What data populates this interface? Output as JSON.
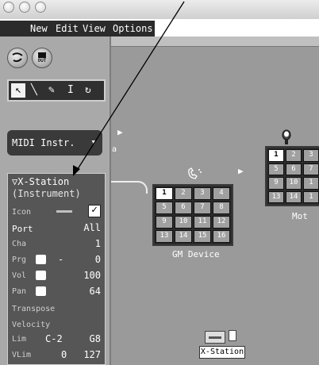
{
  "menubar": {
    "items": [
      "New",
      "Edit",
      "View",
      "Options"
    ]
  },
  "toolbar": {
    "out_label": "OUT"
  },
  "tools": [
    {
      "glyph": "↖",
      "icon": "pointer-tool-icon"
    },
    {
      "glyph": "╲",
      "icon": "pencil-tool-icon"
    },
    {
      "glyph": "✎",
      "icon": "eraser-tool-icon"
    },
    {
      "glyph": "I",
      "icon": "text-tool-icon"
    },
    {
      "glyph": "↻",
      "icon": "cable-tool-icon"
    }
  ],
  "midi_button": {
    "label": "MIDI Instr."
  },
  "inspector": {
    "title": "▽X-Station",
    "subtitle": "(Instrument)",
    "icon_label": "Icon",
    "icon_checked": true,
    "port_label": "Port",
    "port_value": "All",
    "cha_label": "Cha",
    "cha_value": "1",
    "prg_label": "Prg",
    "prg_value": "0",
    "prg_dash": "-",
    "vol_label": "Vol",
    "vol_value": "100",
    "pan_label": "Pan",
    "pan_value": "64",
    "transpose_label": "Transpose",
    "velocity_label": "Velocity",
    "lim_label": "Lim",
    "lim_low": "C-2",
    "lim_high": "G8",
    "vlim_label": "VLim",
    "vlim_low": "0",
    "vlim_high": "127"
  },
  "gm_device": {
    "label": "GM Device",
    "channels": [
      "1",
      "2",
      "3",
      "4",
      "5",
      "6",
      "7",
      "8",
      "9",
      "10",
      "11",
      "12",
      "13",
      "14",
      "15",
      "16"
    ]
  },
  "right_device": {
    "label": "Mot",
    "channels": [
      "1",
      "2",
      "3",
      "5",
      "6",
      "7",
      "9",
      "10",
      "1",
      "13",
      "14",
      "1"
    ]
  },
  "xstation_icon": {
    "label": "X-Station"
  },
  "colors": {
    "inspector_bg": "#565656",
    "canvas_bg": "#9a9a9a",
    "menubar_bg": "#2b2b2b"
  }
}
